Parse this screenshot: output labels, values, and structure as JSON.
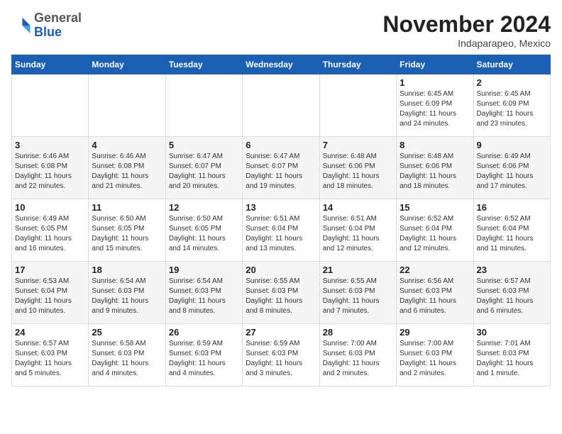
{
  "logo": {
    "general": "General",
    "blue": "Blue"
  },
  "header": {
    "month": "November 2024",
    "location": "Indaparapeo, Mexico"
  },
  "weekdays": [
    "Sunday",
    "Monday",
    "Tuesday",
    "Wednesday",
    "Thursday",
    "Friday",
    "Saturday"
  ],
  "weeks": [
    [
      {
        "day": "",
        "info": ""
      },
      {
        "day": "",
        "info": ""
      },
      {
        "day": "",
        "info": ""
      },
      {
        "day": "",
        "info": ""
      },
      {
        "day": "",
        "info": ""
      },
      {
        "day": "1",
        "info": "Sunrise: 6:45 AM\nSunset: 6:09 PM\nDaylight: 11 hours\nand 24 minutes."
      },
      {
        "day": "2",
        "info": "Sunrise: 6:45 AM\nSunset: 6:09 PM\nDaylight: 11 hours\nand 23 minutes."
      }
    ],
    [
      {
        "day": "3",
        "info": "Sunrise: 6:46 AM\nSunset: 6:08 PM\nDaylight: 11 hours\nand 22 minutes."
      },
      {
        "day": "4",
        "info": "Sunrise: 6:46 AM\nSunset: 6:08 PM\nDaylight: 11 hours\nand 21 minutes."
      },
      {
        "day": "5",
        "info": "Sunrise: 6:47 AM\nSunset: 6:07 PM\nDaylight: 11 hours\nand 20 minutes."
      },
      {
        "day": "6",
        "info": "Sunrise: 6:47 AM\nSunset: 6:07 PM\nDaylight: 11 hours\nand 19 minutes."
      },
      {
        "day": "7",
        "info": "Sunrise: 6:48 AM\nSunset: 6:06 PM\nDaylight: 11 hours\nand 18 minutes."
      },
      {
        "day": "8",
        "info": "Sunrise: 6:48 AM\nSunset: 6:06 PM\nDaylight: 11 hours\nand 18 minutes."
      },
      {
        "day": "9",
        "info": "Sunrise: 6:49 AM\nSunset: 6:06 PM\nDaylight: 11 hours\nand 17 minutes."
      }
    ],
    [
      {
        "day": "10",
        "info": "Sunrise: 6:49 AM\nSunset: 6:05 PM\nDaylight: 11 hours\nand 16 minutes."
      },
      {
        "day": "11",
        "info": "Sunrise: 6:50 AM\nSunset: 6:05 PM\nDaylight: 11 hours\nand 15 minutes."
      },
      {
        "day": "12",
        "info": "Sunrise: 6:50 AM\nSunset: 6:05 PM\nDaylight: 11 hours\nand 14 minutes."
      },
      {
        "day": "13",
        "info": "Sunrise: 6:51 AM\nSunset: 6:04 PM\nDaylight: 11 hours\nand 13 minutes."
      },
      {
        "day": "14",
        "info": "Sunrise: 6:51 AM\nSunset: 6:04 PM\nDaylight: 11 hours\nand 12 minutes."
      },
      {
        "day": "15",
        "info": "Sunrise: 6:52 AM\nSunset: 6:04 PM\nDaylight: 11 hours\nand 12 minutes."
      },
      {
        "day": "16",
        "info": "Sunrise: 6:52 AM\nSunset: 6:04 PM\nDaylight: 11 hours\nand 11 minutes."
      }
    ],
    [
      {
        "day": "17",
        "info": "Sunrise: 6:53 AM\nSunset: 6:04 PM\nDaylight: 11 hours\nand 10 minutes."
      },
      {
        "day": "18",
        "info": "Sunrise: 6:54 AM\nSunset: 6:03 PM\nDaylight: 11 hours\nand 9 minutes."
      },
      {
        "day": "19",
        "info": "Sunrise: 6:54 AM\nSunset: 6:03 PM\nDaylight: 11 hours\nand 8 minutes."
      },
      {
        "day": "20",
        "info": "Sunrise: 6:55 AM\nSunset: 6:03 PM\nDaylight: 11 hours\nand 8 minutes."
      },
      {
        "day": "21",
        "info": "Sunrise: 6:55 AM\nSunset: 6:03 PM\nDaylight: 11 hours\nand 7 minutes."
      },
      {
        "day": "22",
        "info": "Sunrise: 6:56 AM\nSunset: 6:03 PM\nDaylight: 11 hours\nand 6 minutes."
      },
      {
        "day": "23",
        "info": "Sunrise: 6:57 AM\nSunset: 6:03 PM\nDaylight: 11 hours\nand 6 minutes."
      }
    ],
    [
      {
        "day": "24",
        "info": "Sunrise: 6:57 AM\nSunset: 6:03 PM\nDaylight: 11 hours\nand 5 minutes."
      },
      {
        "day": "25",
        "info": "Sunrise: 6:58 AM\nSunset: 6:03 PM\nDaylight: 11 hours\nand 4 minutes."
      },
      {
        "day": "26",
        "info": "Sunrise: 6:59 AM\nSunset: 6:03 PM\nDaylight: 11 hours\nand 4 minutes."
      },
      {
        "day": "27",
        "info": "Sunrise: 6:59 AM\nSunset: 6:03 PM\nDaylight: 11 hours\nand 3 minutes."
      },
      {
        "day": "28",
        "info": "Sunrise: 7:00 AM\nSunset: 6:03 PM\nDaylight: 11 hours\nand 2 minutes."
      },
      {
        "day": "29",
        "info": "Sunrise: 7:00 AM\nSunset: 6:03 PM\nDaylight: 11 hours\nand 2 minutes."
      },
      {
        "day": "30",
        "info": "Sunrise: 7:01 AM\nSunset: 6:03 PM\nDaylight: 11 hours\nand 1 minute."
      }
    ]
  ]
}
